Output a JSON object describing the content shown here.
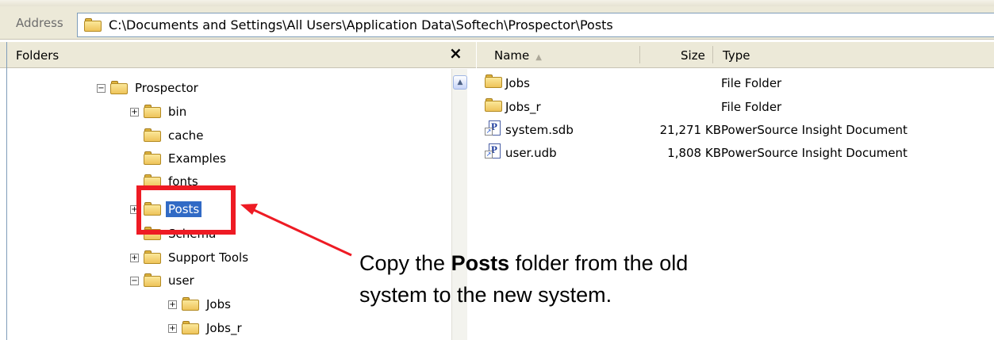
{
  "address": {
    "label": "Address",
    "path": "C:\\Documents and Settings\\All Users\\Application Data\\Softech\\Prospector\\Posts"
  },
  "folders_pane": {
    "title": "Folders",
    "close_symbol": "×",
    "tree": [
      {
        "label": "Prospector",
        "expander": "⊟"
      },
      {
        "label": "bin",
        "expander": "⊞"
      },
      {
        "label": "cache",
        "expander": ""
      },
      {
        "label": "Examples",
        "expander": ""
      },
      {
        "label": "fonts",
        "expander": ""
      },
      {
        "label": "Posts",
        "expander": "⊞",
        "selected": true
      },
      {
        "label": "Schema",
        "expander": ""
      },
      {
        "label": "Support Tools",
        "expander": "⊞"
      },
      {
        "label": "user",
        "expander": "⊟"
      },
      {
        "label": "Jobs",
        "expander": "⊞"
      },
      {
        "label": "Jobs_r",
        "expander": "⊞"
      }
    ]
  },
  "file_list": {
    "columns": {
      "name": "Name",
      "size": "Size",
      "type": "Type"
    },
    "rows": [
      {
        "name": "Jobs",
        "size": "",
        "type": "File Folder",
        "icon": "folder-icon"
      },
      {
        "name": "Jobs_r",
        "size": "",
        "type": "File Folder",
        "icon": "folder-icon"
      },
      {
        "name": "system.sdb",
        "size": "21,271 KB",
        "type": "PowerSource Insight Document",
        "icon": "document-shortcut-icon"
      },
      {
        "name": "user.udb",
        "size": "1,808 KB",
        "type": "PowerSource Insight Document",
        "icon": "document-shortcut-icon"
      }
    ]
  },
  "callout": {
    "text_before": "Copy the ",
    "text_bold": "Posts",
    "text_after": " folder from the old system to the new system."
  },
  "colors": {
    "callout_red": "#ee1b24",
    "selection_blue": "#316ac5",
    "toolbar_beige": "#ece9d8"
  }
}
